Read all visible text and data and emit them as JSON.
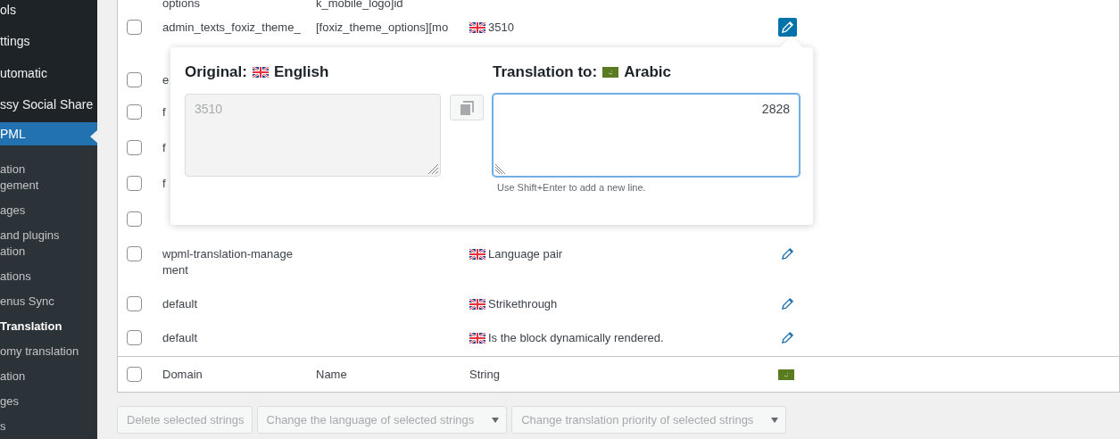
{
  "sidebar": {
    "top_items": [
      {
        "label": "ols"
      },
      {
        "label": "ttings"
      },
      {
        "label": "utomatic"
      },
      {
        "label": "ssy Social Share"
      }
    ],
    "open_item": {
      "label": "PML",
      "selected": true
    },
    "sub_items": [
      {
        "label": "ation\ngement",
        "selected": false
      },
      {
        "label": "ages",
        "selected": false
      },
      {
        "label": "and plugins\nation",
        "selected": false
      },
      {
        "label": "ations",
        "selected": false
      },
      {
        "label": "enus Sync",
        "selected": false
      },
      {
        "label": "Translation",
        "selected": true
      },
      {
        "label": "omy translation",
        "selected": false
      },
      {
        "label": "ation",
        "selected": false
      },
      {
        "label": "ges",
        "selected": false
      },
      {
        "label": "s",
        "selected": false
      }
    ]
  },
  "table": {
    "cut_row": {
      "domain": "options",
      "name": "k_mobile_logo]id"
    },
    "rows": [
      {
        "domain": "admin_texts_foxiz_theme_",
        "name": "[foxiz_theme_options][mo",
        "string": "3510",
        "checked": false,
        "editing": true
      },
      {
        "domain": "e",
        "checked": false
      },
      {
        "domain": "f",
        "checked": false
      },
      {
        "domain": "f",
        "checked": false
      },
      {
        "domain": "f",
        "checked": false
      },
      {
        "checked": false
      },
      {
        "domain": "wpml-translation-manage\nment",
        "string": "Language pair",
        "checked": false,
        "editing": false
      },
      {
        "domain": "default",
        "string": "Strikethrough",
        "checked": false,
        "editing": false
      },
      {
        "domain": "default",
        "string": "Is the block dynamically rendered.",
        "checked": false,
        "editing": false
      }
    ],
    "footer": {
      "checked": false,
      "columns": [
        "Domain",
        "Name",
        "String"
      ]
    }
  },
  "popup": {
    "original_label": "Original:",
    "original_language": "English",
    "original_value": "3510",
    "translation_label": "Translation to:",
    "translation_language": "Arabic",
    "translation_value": "2828",
    "hint": "Use Shift+Enter to add a new line."
  },
  "bulk_actions": [
    {
      "kind": "button",
      "label": "Delete selected strings",
      "disabled": true
    },
    {
      "kind": "select",
      "label": "Change the language of selected strings",
      "disabled": true
    },
    {
      "kind": "select",
      "label": "Change translation priority of selected strings",
      "disabled": true
    }
  ]
}
